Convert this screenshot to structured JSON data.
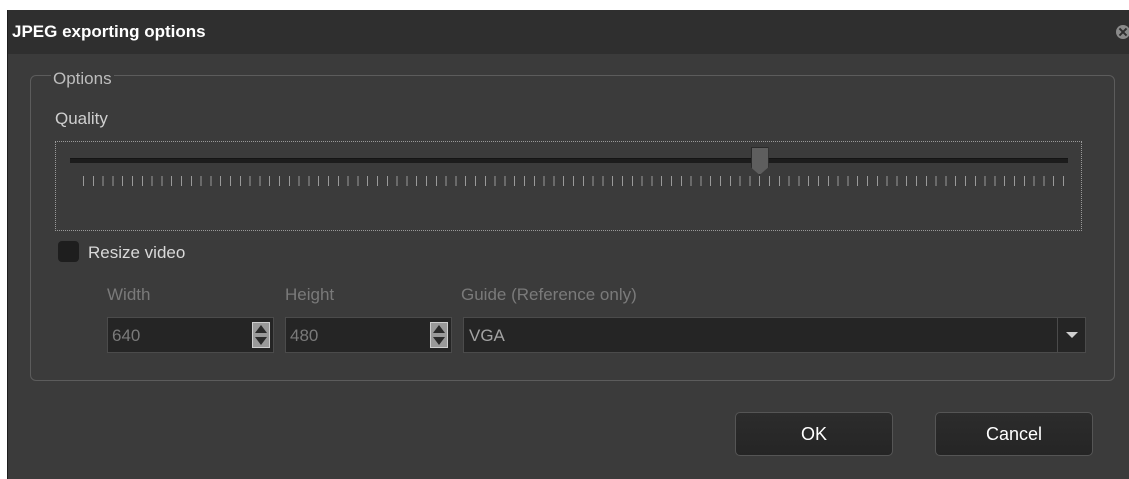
{
  "window": {
    "title": "JPEG exporting options"
  },
  "options_group": {
    "legend": "Options",
    "quality": {
      "label": "Quality",
      "value_fraction": 0.69
    },
    "resize": {
      "label": "Resize video",
      "checked": false,
      "width": {
        "label": "Width",
        "value": "640"
      },
      "height": {
        "label": "Height",
        "value": "480"
      },
      "guide": {
        "label": "Guide (Reference only)",
        "selected": "VGA"
      }
    }
  },
  "buttons": {
    "ok": "OK",
    "cancel": "Cancel"
  }
}
